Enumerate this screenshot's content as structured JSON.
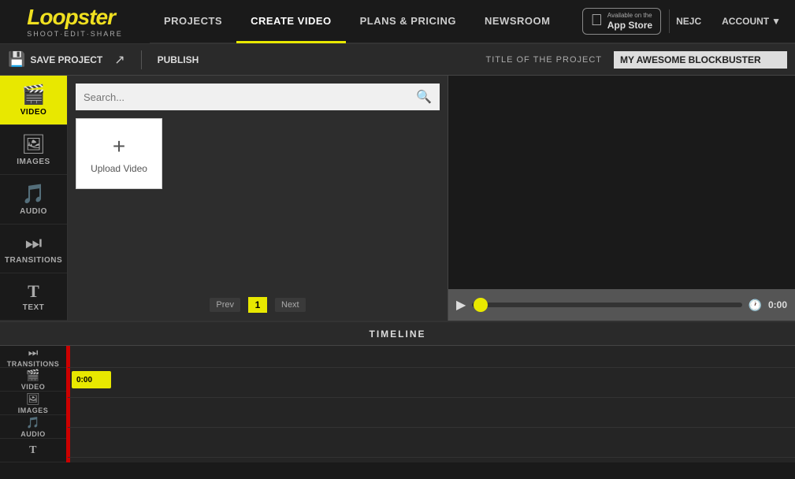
{
  "nav": {
    "logo": "Loopster",
    "logo_sub": "SHOOT·EDIT·SHARE",
    "items": [
      {
        "label": "PROJECTS",
        "active": false
      },
      {
        "label": "CREATE VIDEO",
        "active": true
      },
      {
        "label": "PLANS & PRICING",
        "active": false
      },
      {
        "label": "NEWSROOM",
        "active": false
      }
    ],
    "appstore": {
      "available": "Available on the",
      "name": "App Store"
    },
    "user": "NEJC",
    "account": "ACCOUNT"
  },
  "toolbar": {
    "save_label": "SAVE PROJECT",
    "publish_label": "PUBLISH",
    "title_label": "TITLE OF THE PROJECT",
    "project_title": "MY AWESOME BLOCKBUSTER"
  },
  "sidebar": {
    "items": [
      {
        "label": "VIDEO",
        "icon": "🎬",
        "active": true
      },
      {
        "label": "IMAGES",
        "icon": "🖼",
        "active": false
      },
      {
        "label": "AUDIO",
        "icon": "🎵",
        "active": false
      },
      {
        "label": "TRANSITIONS",
        "icon": "⏭",
        "active": false
      },
      {
        "label": "TEXT",
        "icon": "T",
        "active": false
      }
    ]
  },
  "content": {
    "search_placeholder": "Search...",
    "upload_label": "Upload Video"
  },
  "pagination": {
    "prev": "Prev",
    "current": "1",
    "next": "Next"
  },
  "playback": {
    "time": "0:00"
  },
  "timeline": {
    "title": "TIMELINE",
    "tracks": [
      {
        "label": "TRANSITIONS",
        "icon": "⏭"
      },
      {
        "label": "VIDEO",
        "icon": "🎬"
      },
      {
        "label": "IMAGES",
        "icon": "🖼"
      },
      {
        "label": "AUDIO",
        "icon": "🎵"
      },
      {
        "label": "T",
        "icon": ""
      }
    ],
    "clip_time": "0:00"
  }
}
